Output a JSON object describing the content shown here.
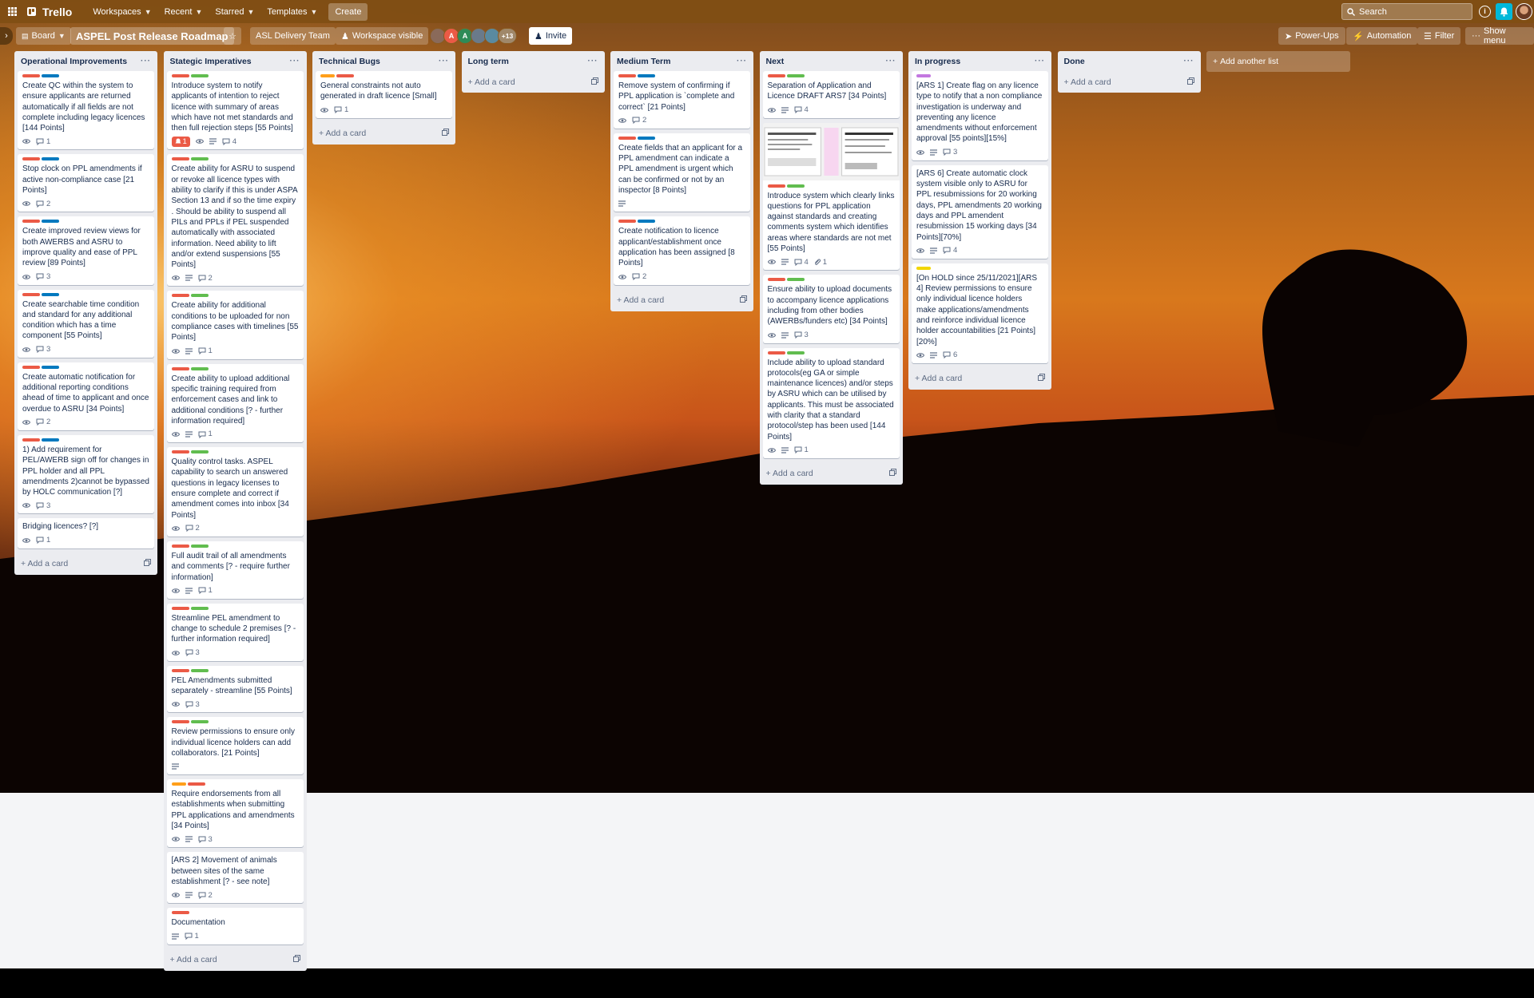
{
  "topbar": {
    "logo": "Trello",
    "menus": [
      "Workspaces",
      "Recent",
      "Starred",
      "Templates"
    ],
    "create_label": "Create",
    "search_placeholder": "Search"
  },
  "boardbar": {
    "view_label": "Board",
    "title": "ASPEL Post Release Roadmap",
    "team": "ASL Delivery Team",
    "visibility": "Workspace visible",
    "avatar_letters": [
      "A",
      "A"
    ],
    "extra_members": "+13",
    "invite_label": "Invite",
    "powerups_label": "Power-Ups",
    "automation_label": "Automation",
    "filter_label": "Filter",
    "show_menu_label": "Show menu"
  },
  "colors": {
    "red": "#eb5a46",
    "blue": "#0079bf",
    "green": "#61bd4f",
    "orange": "#ff9f1a",
    "yellow": "#f2d600",
    "purple": "#c377e0"
  },
  "add_card_label": "Add a card",
  "add_list_label": "Add another list",
  "lists": [
    {
      "name": "Operational Improvements",
      "cards": [
        {
          "labels": [
            "red",
            "blue"
          ],
          "title": "Create QC within the system to ensure applicants are returned automatically if all fields are not complete including legacy licences [144 Points]",
          "watch": true,
          "desc": false,
          "comments": "1"
        },
        {
          "labels": [
            "red",
            "blue"
          ],
          "title": "Stop clock on PPL amendments if active non-compliance case [21 Points]",
          "watch": true,
          "desc": false,
          "comments": "2"
        },
        {
          "labels": [
            "red",
            "blue"
          ],
          "title": "Create improved review views for both AWERBS and ASRU to improve quality and ease of PPL review [89 Points]",
          "watch": true,
          "desc": false,
          "comments": "3"
        },
        {
          "labels": [
            "red",
            "blue"
          ],
          "title": "Create searchable time condition and standard for any additional condition which has a time component [55 Points]",
          "watch": true,
          "desc": false,
          "comments": "3"
        },
        {
          "labels": [
            "red",
            "blue"
          ],
          "title": "Create automatic notification for additional reporting conditions ahead of time to applicant and once overdue to ASRU [34 Points]",
          "watch": true,
          "desc": false,
          "comments": "2"
        },
        {
          "labels": [
            "red",
            "blue"
          ],
          "title": "1) Add requirement for PEL/AWERB sign off for changes in PPL holder and all PPL amendments 2)cannot be bypassed by HOLC communication [?]",
          "watch": true,
          "desc": false,
          "comments": "3"
        },
        {
          "labels": [],
          "title": "Bridging licences? [?]",
          "watch": true,
          "desc": false,
          "comments": "1"
        }
      ]
    },
    {
      "name": "Stategic Imperatives",
      "cards": [
        {
          "labels": [
            "red",
            "green"
          ],
          "title": "Introduce system to notify applicants of intention to reject licence with summary of areas which have not met standards and then full rejection steps [55 Points]",
          "alert": "1",
          "watch": true,
          "desc": true,
          "comments": "4"
        },
        {
          "labels": [
            "red",
            "green"
          ],
          "title": "Create ability for ASRU to suspend or revoke all licence types with ability to clarify if this is under ASPA Section 13 and if so the time expiry . Should be ability to suspend all PILs and PPLs if PEL suspended automatically with associated information. Need ability to lift and/or extend suspensions [55 Points]",
          "watch": true,
          "desc": true,
          "comments": "2"
        },
        {
          "labels": [
            "red",
            "green"
          ],
          "title": "Create ability for additional conditions to be uploaded for non compliance cases with timelines [55 Points]",
          "watch": true,
          "desc": true,
          "comments": "1"
        },
        {
          "labels": [
            "red",
            "green"
          ],
          "title": "Create ability to upload additional specific training required from enforcement cases and link to additional conditions [? - further information required]",
          "watch": true,
          "desc": true,
          "comments": "1"
        },
        {
          "labels": [
            "red",
            "green"
          ],
          "title": "Quality control tasks. ASPEL capability to search un answered questions in legacy licenses to ensure complete and correct if amendment comes into inbox [34 Points]",
          "watch": true,
          "desc": false,
          "comments": "2"
        },
        {
          "labels": [
            "red",
            "green"
          ],
          "title": "Full audit trail of all amendments and comments [? - require further information]",
          "watch": true,
          "desc": true,
          "comments": "1"
        },
        {
          "labels": [
            "red",
            "green"
          ],
          "title": "Streamline PEL amendment to change to schedule 2 premises [? - further information required]",
          "watch": true,
          "desc": false,
          "comments": "3"
        },
        {
          "labels": [
            "red",
            "green"
          ],
          "title": "PEL Amendments submitted separately - streamline [55 Points]",
          "watch": true,
          "desc": false,
          "comments": "3"
        },
        {
          "labels": [
            "red",
            "green"
          ],
          "title": "Review permissions to ensure only individual licence holders can add collaborators. [21 Points]",
          "watch": false,
          "desc": true,
          "comments": ""
        },
        {
          "labels": [
            "orange",
            "red"
          ],
          "title": "Require endorsements from all establishments when submitting PPL applications and amendments [34 Points]",
          "watch": true,
          "desc": true,
          "comments": "3"
        },
        {
          "labels": [],
          "title": "[ARS 2] Movement of animals between sites of the same establishment [? - see note]",
          "watch": true,
          "desc": true,
          "comments": "2"
        },
        {
          "labels": [
            "red"
          ],
          "title": "Documentation",
          "watch": false,
          "desc": true,
          "comments": "1"
        }
      ]
    },
    {
      "name": "Technical Bugs",
      "cards": [
        {
          "labels": [
            "orange",
            "red"
          ],
          "title": "General constraints not auto generated in draft licence [Small]",
          "watch": true,
          "desc": false,
          "comments": "1"
        }
      ]
    },
    {
      "name": "Long term",
      "cards": []
    },
    {
      "name": "Medium Term",
      "cards": [
        {
          "labels": [
            "red",
            "blue"
          ],
          "title": "Remove system of confirming if PPL application is `complete and correct` [21 Points]",
          "watch": true,
          "desc": false,
          "comments": "2"
        },
        {
          "labels": [
            "red",
            "blue"
          ],
          "title": "Create fields that an applicant for a PPL amendment can indicate a PPL amendment is urgent which can be confirmed or not by an inspector [8 Points]",
          "watch": false,
          "desc": true,
          "comments": ""
        },
        {
          "labels": [
            "red",
            "blue"
          ],
          "title": "Create notification to licence applicant/establishment once application has been assigned [8 Points]",
          "watch": true,
          "desc": false,
          "comments": "2"
        }
      ]
    },
    {
      "name": "Next",
      "cards": [
        {
          "labels": [
            "red",
            "green"
          ],
          "title": "Separation of Application and Licence DRAFT ARS7 [34 Points]",
          "watch": true,
          "desc": true,
          "comments": "4"
        },
        {
          "labels": [
            "red",
            "green"
          ],
          "title": "Introduce system which clearly links questions for PPL application against standards and creating comments system which identifies areas where standards are not met [55 Points]",
          "thumb": true,
          "watch": true,
          "desc": true,
          "comments": "4",
          "attachments": "1"
        },
        {
          "labels": [
            "red",
            "green"
          ],
          "title": "Ensure ability to upload documents to accompany licence applications including from other bodies (AWERBs/funders etc) [34 Points]",
          "watch": true,
          "desc": true,
          "comments": "3"
        },
        {
          "labels": [
            "red",
            "green"
          ],
          "title": "Include ability to upload standard protocols(eg GA or simple maintenance licences) and/or steps by ASRU which can be utilised by applicants. This must be associated with clarity that a standard protocol/step has been used [144 Points]",
          "watch": true,
          "desc": true,
          "comments": "1"
        }
      ]
    },
    {
      "name": "In progress",
      "cards": [
        {
          "labels": [
            "purple"
          ],
          "title": "[ARS 1] Create flag on any licence type to notify that a non compliance investigation is underway and preventing any licence amendments without enforcement approval [55 points][15%]",
          "watch": true,
          "desc": true,
          "comments": "3"
        },
        {
          "labels": [],
          "title": "[ARS 6] Create automatic clock system visible only to ASRU for PPL resubmissions for 20 working days, PPL amendments 20 working days and PPL amendent resubmission 15 working days [34 Points][70%]",
          "watch": true,
          "desc": true,
          "comments": "4"
        },
        {
          "labels": [
            "yellow"
          ],
          "title": "[On HOLD since 25/11/2021][ARS 4] Review permissions to ensure only individual licence holders make applications/amendments and reinforce individual licence holder accountabilities [21 Points][20%]",
          "watch": true,
          "desc": true,
          "comments": "6"
        }
      ]
    },
    {
      "name": "Done",
      "cards": []
    }
  ]
}
